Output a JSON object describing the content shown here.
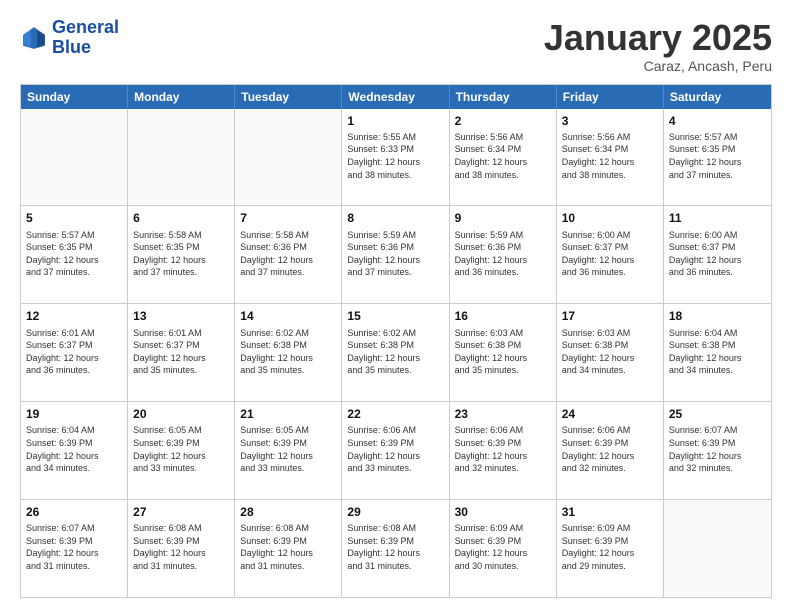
{
  "logo": {
    "line1": "General",
    "line2": "Blue"
  },
  "header": {
    "month": "January 2025",
    "location": "Caraz, Ancash, Peru"
  },
  "weekdays": [
    "Sunday",
    "Monday",
    "Tuesday",
    "Wednesday",
    "Thursday",
    "Friday",
    "Saturday"
  ],
  "weeks": [
    [
      {
        "day": "",
        "text": ""
      },
      {
        "day": "",
        "text": ""
      },
      {
        "day": "",
        "text": ""
      },
      {
        "day": "1",
        "text": "Sunrise: 5:55 AM\nSunset: 6:33 PM\nDaylight: 12 hours\nand 38 minutes."
      },
      {
        "day": "2",
        "text": "Sunrise: 5:56 AM\nSunset: 6:34 PM\nDaylight: 12 hours\nand 38 minutes."
      },
      {
        "day": "3",
        "text": "Sunrise: 5:56 AM\nSunset: 6:34 PM\nDaylight: 12 hours\nand 38 minutes."
      },
      {
        "day": "4",
        "text": "Sunrise: 5:57 AM\nSunset: 6:35 PM\nDaylight: 12 hours\nand 37 minutes."
      }
    ],
    [
      {
        "day": "5",
        "text": "Sunrise: 5:57 AM\nSunset: 6:35 PM\nDaylight: 12 hours\nand 37 minutes."
      },
      {
        "day": "6",
        "text": "Sunrise: 5:58 AM\nSunset: 6:35 PM\nDaylight: 12 hours\nand 37 minutes."
      },
      {
        "day": "7",
        "text": "Sunrise: 5:58 AM\nSunset: 6:36 PM\nDaylight: 12 hours\nand 37 minutes."
      },
      {
        "day": "8",
        "text": "Sunrise: 5:59 AM\nSunset: 6:36 PM\nDaylight: 12 hours\nand 37 minutes."
      },
      {
        "day": "9",
        "text": "Sunrise: 5:59 AM\nSunset: 6:36 PM\nDaylight: 12 hours\nand 36 minutes."
      },
      {
        "day": "10",
        "text": "Sunrise: 6:00 AM\nSunset: 6:37 PM\nDaylight: 12 hours\nand 36 minutes."
      },
      {
        "day": "11",
        "text": "Sunrise: 6:00 AM\nSunset: 6:37 PM\nDaylight: 12 hours\nand 36 minutes."
      }
    ],
    [
      {
        "day": "12",
        "text": "Sunrise: 6:01 AM\nSunset: 6:37 PM\nDaylight: 12 hours\nand 36 minutes."
      },
      {
        "day": "13",
        "text": "Sunrise: 6:01 AM\nSunset: 6:37 PM\nDaylight: 12 hours\nand 35 minutes."
      },
      {
        "day": "14",
        "text": "Sunrise: 6:02 AM\nSunset: 6:38 PM\nDaylight: 12 hours\nand 35 minutes."
      },
      {
        "day": "15",
        "text": "Sunrise: 6:02 AM\nSunset: 6:38 PM\nDaylight: 12 hours\nand 35 minutes."
      },
      {
        "day": "16",
        "text": "Sunrise: 6:03 AM\nSunset: 6:38 PM\nDaylight: 12 hours\nand 35 minutes."
      },
      {
        "day": "17",
        "text": "Sunrise: 6:03 AM\nSunset: 6:38 PM\nDaylight: 12 hours\nand 34 minutes."
      },
      {
        "day": "18",
        "text": "Sunrise: 6:04 AM\nSunset: 6:38 PM\nDaylight: 12 hours\nand 34 minutes."
      }
    ],
    [
      {
        "day": "19",
        "text": "Sunrise: 6:04 AM\nSunset: 6:39 PM\nDaylight: 12 hours\nand 34 minutes."
      },
      {
        "day": "20",
        "text": "Sunrise: 6:05 AM\nSunset: 6:39 PM\nDaylight: 12 hours\nand 33 minutes."
      },
      {
        "day": "21",
        "text": "Sunrise: 6:05 AM\nSunset: 6:39 PM\nDaylight: 12 hours\nand 33 minutes."
      },
      {
        "day": "22",
        "text": "Sunrise: 6:06 AM\nSunset: 6:39 PM\nDaylight: 12 hours\nand 33 minutes."
      },
      {
        "day": "23",
        "text": "Sunrise: 6:06 AM\nSunset: 6:39 PM\nDaylight: 12 hours\nand 32 minutes."
      },
      {
        "day": "24",
        "text": "Sunrise: 6:06 AM\nSunset: 6:39 PM\nDaylight: 12 hours\nand 32 minutes."
      },
      {
        "day": "25",
        "text": "Sunrise: 6:07 AM\nSunset: 6:39 PM\nDaylight: 12 hours\nand 32 minutes."
      }
    ],
    [
      {
        "day": "26",
        "text": "Sunrise: 6:07 AM\nSunset: 6:39 PM\nDaylight: 12 hours\nand 31 minutes."
      },
      {
        "day": "27",
        "text": "Sunrise: 6:08 AM\nSunset: 6:39 PM\nDaylight: 12 hours\nand 31 minutes."
      },
      {
        "day": "28",
        "text": "Sunrise: 6:08 AM\nSunset: 6:39 PM\nDaylight: 12 hours\nand 31 minutes."
      },
      {
        "day": "29",
        "text": "Sunrise: 6:08 AM\nSunset: 6:39 PM\nDaylight: 12 hours\nand 31 minutes."
      },
      {
        "day": "30",
        "text": "Sunrise: 6:09 AM\nSunset: 6:39 PM\nDaylight: 12 hours\nand 30 minutes."
      },
      {
        "day": "31",
        "text": "Sunrise: 6:09 AM\nSunset: 6:39 PM\nDaylight: 12 hours\nand 29 minutes."
      },
      {
        "day": "",
        "text": ""
      }
    ]
  ]
}
